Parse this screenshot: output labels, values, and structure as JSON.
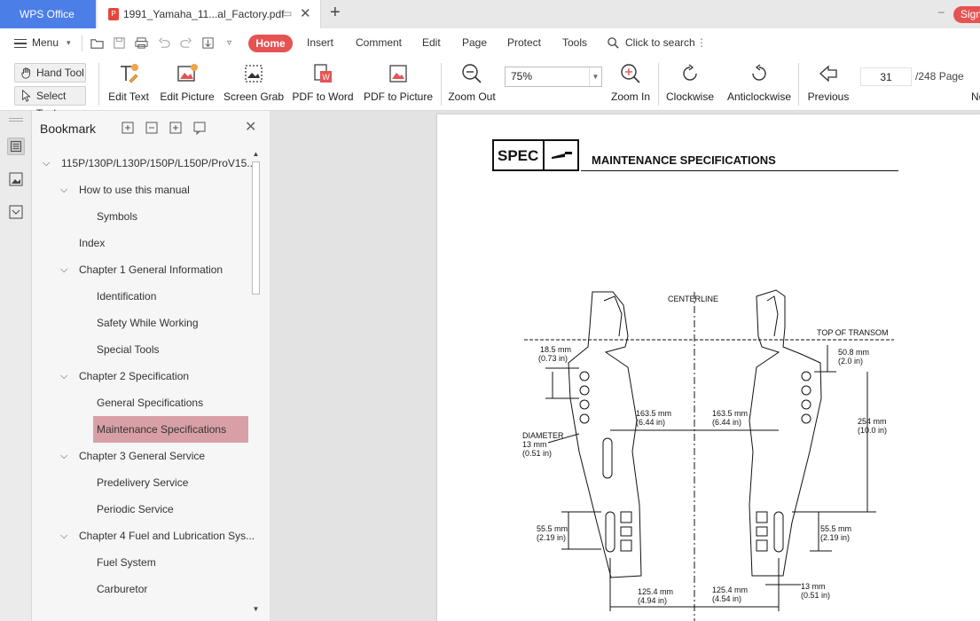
{
  "tabbar": {
    "app_title": "WPS Office",
    "doc_name": "1991_Yamaha_11...al_Factory.pdf",
    "new_tab": "+",
    "minimize": "–",
    "sign_in": "Sign"
  },
  "menubar": {
    "menu": "Menu",
    "tabs": [
      "Home",
      "Insert",
      "Comment",
      "Edit",
      "Page",
      "Protect",
      "Tools"
    ],
    "search": "Click to search"
  },
  "ribbon": {
    "hand_tool": "Hand Tool",
    "select_tool": "Select Tool",
    "edit_text": "Edit Text",
    "edit_picture": "Edit Picture",
    "screen_grab": "Screen Grab",
    "pdf_to_word": "PDF to Word",
    "pdf_to_picture": "PDF to Picture",
    "zoom_out": "Zoom Out",
    "zoom_value": "75%",
    "zoom_in": "Zoom In",
    "clockwise": "Clockwise",
    "anticlockwise": "Anticlockwise",
    "previous": "Previous",
    "page_current": "31",
    "page_total": "/248 Page",
    "next_partial": "Ne"
  },
  "bookmark": {
    "title": "Bookmark",
    "items": [
      {
        "label": "115P/130P/L130P/150P/L150P/ProV15...",
        "level": 0,
        "expanded": true
      },
      {
        "label": "How to use this manual",
        "level": 1,
        "expanded": true
      },
      {
        "label": "Symbols",
        "level": 2
      },
      {
        "label": "Index",
        "level": 1
      },
      {
        "label": "Chapter 1 General Information",
        "level": 1,
        "expanded": true
      },
      {
        "label": "Identification",
        "level": 2
      },
      {
        "label": "Safety While Working",
        "level": 2
      },
      {
        "label": "Special Tools",
        "level": 2
      },
      {
        "label": "Chapter 2 Specification",
        "level": 1,
        "expanded": true
      },
      {
        "label": "General Specifications",
        "level": 2
      },
      {
        "label": "Maintenance Specifications",
        "level": 2,
        "selected": true
      },
      {
        "label": "Chapter 3 General Service",
        "level": 1,
        "expanded": true
      },
      {
        "label": "Predelivery Service",
        "level": 2
      },
      {
        "label": "Periodic Service",
        "level": 2
      },
      {
        "label": "Chapter 4 Fuel and Lubrication Sys...",
        "level": 1,
        "expanded": true
      },
      {
        "label": "Fuel System",
        "level": 2
      },
      {
        "label": "Carburetor",
        "level": 2
      }
    ]
  },
  "document": {
    "spec_label": "SPEC",
    "heading": "MAINTENANCE SPECIFICATIONS",
    "labels": {
      "centerline": "CENTERLINE",
      "top_of_transom": "TOP OF TRANSOM",
      "d1": "18.5 mm",
      "d1_in": "(0.73 in)",
      "d2": "50.8 mm",
      "d2_in": "(2.0 in)",
      "d3": "163.5 mm",
      "d3_in": "(6.44 in)",
      "d4": "163.5 mm",
      "d4_in": "(6.44 in)",
      "d5": "254 mm",
      "d5_in": "(10.0 in)",
      "diameter": "DIAMETER",
      "dia_mm": "13 mm",
      "dia_in": "(0.51 in)",
      "d6": "55.5 mm",
      "d6_in": "(2.19 in)",
      "d7": "55.5 mm",
      "d7_in": "(2.19 in)",
      "d8": "125.4 mm",
      "d8_in": "(4.94 in)",
      "d9": "125.4 mm",
      "d9_in": "(4.54 in)",
      "d10": "13 mm",
      "d10_in": "(0.51 in)"
    }
  },
  "colors": {
    "accent": "#e55353",
    "app_tab": "#4c7ee8",
    "bookmark_selected": "#d8a0a6"
  }
}
